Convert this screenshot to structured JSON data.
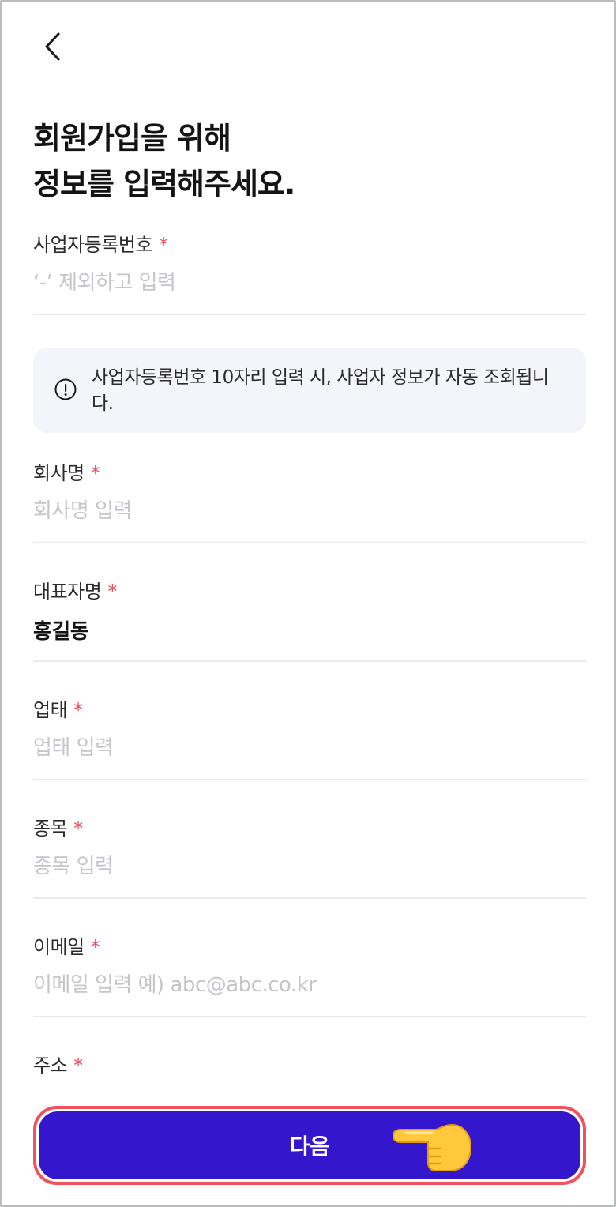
{
  "header": {
    "title_line1": "회원가입을 위해",
    "title_line2": "정보를 입력해주세요."
  },
  "required_mark": "*",
  "fields": [
    {
      "label": "사업자등록번호",
      "placeholder": "‘-’ 제외하고 입력",
      "value": ""
    },
    {
      "label": "회사명",
      "placeholder": "회사명 입력",
      "value": ""
    },
    {
      "label": "대표자명",
      "placeholder": "",
      "value": "홍길동"
    },
    {
      "label": "업태",
      "placeholder": "업태 입력",
      "value": ""
    },
    {
      "label": "종목",
      "placeholder": "종목 입력",
      "value": ""
    },
    {
      "label": "이메일",
      "placeholder": "이메일 입력 예) abc@abc.co.kr",
      "value": ""
    },
    {
      "label": "주소"
    }
  ],
  "notice": {
    "text": "사업자등록번호 10자리 입력 시, 사업자 정보가 자동 조회됩니다."
  },
  "next_button": {
    "label": "다음"
  },
  "colors": {
    "primary": "#3417cc",
    "required": "#e9505a",
    "highlight_border": "#f0525d",
    "notice_bg": "#f4f4fb"
  },
  "icons": {
    "back": "chevron-left-icon",
    "notice": "info-circle-icon",
    "pointer": "pointing-hand-icon"
  }
}
